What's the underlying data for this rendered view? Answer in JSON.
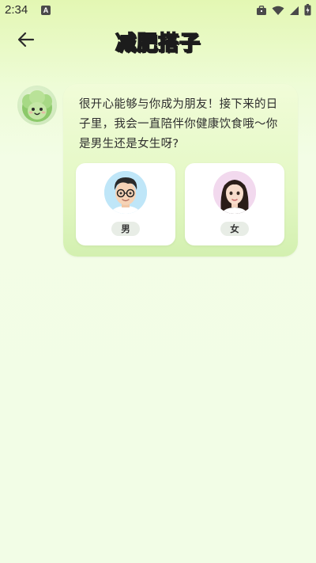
{
  "status_bar": {
    "time": "2:34",
    "notification_badge": "A",
    "icons": [
      "briefcase-icon",
      "wifi-icon",
      "signal-icon",
      "battery-icon"
    ]
  },
  "header": {
    "title_part1": "减肥",
    "title_part2": "搭子",
    "back_icon": "arrow-left-icon"
  },
  "chat": {
    "bot_avatar": "lettuce-mascot",
    "message": "很开心能够与你成为朋友！接下来的日子里，我会一直陪伴你健康饮食哦～你是男生还是女生呀?",
    "options": [
      {
        "label": "男",
        "avatar": "boy-avatar"
      },
      {
        "label": "女",
        "avatar": "girl-avatar"
      }
    ]
  },
  "colors": {
    "accent_green": "#9fe025",
    "bubble_bg": "#e4f8c5",
    "page_bg": "#f2fde6"
  }
}
